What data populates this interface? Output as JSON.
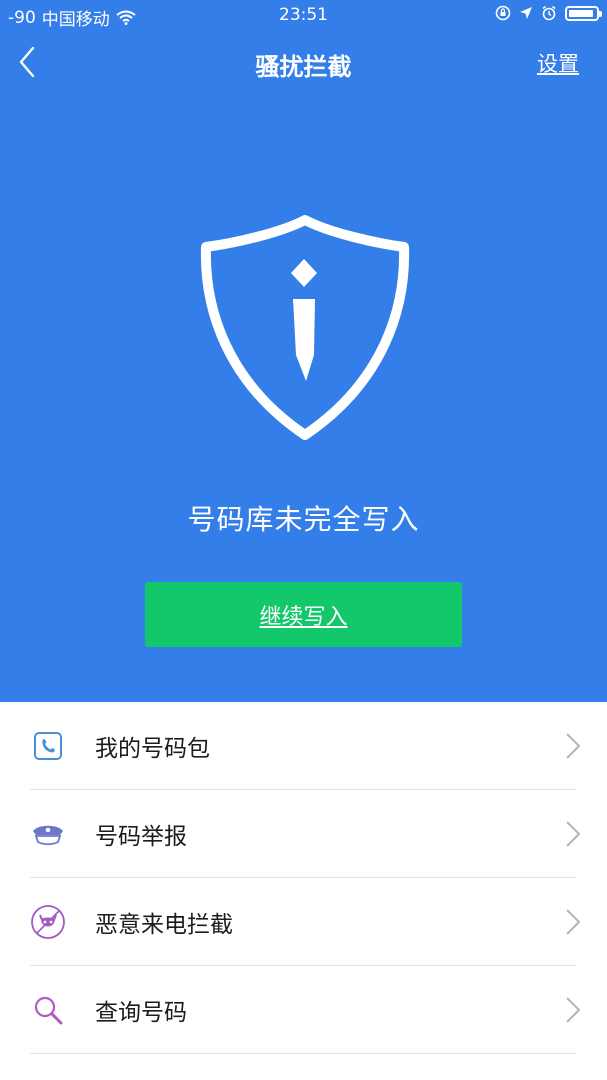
{
  "status_bar": {
    "signal": "-90",
    "carrier": "中国移动",
    "time": "23:51"
  },
  "nav": {
    "title": "骚扰拦截",
    "settings_label": "设置"
  },
  "hero": {
    "status_text": "号码库未完全写入",
    "button_label": "继续写入",
    "shield_icon": "shield-info-icon"
  },
  "menu": {
    "items": [
      {
        "label": "我的号码包",
        "icon": "phone-icon",
        "color": "#4a90d9"
      },
      {
        "label": "号码举报",
        "icon": "police-cap-icon",
        "color": "#6b77c8"
      },
      {
        "label": "恶意来电拦截",
        "icon": "devil-block-icon",
        "color": "#a05cc0"
      },
      {
        "label": "查询号码",
        "icon": "search-icon",
        "color": "#b05ac4"
      }
    ]
  },
  "colors": {
    "primary": "#337ee8",
    "button": "#12c86a"
  }
}
